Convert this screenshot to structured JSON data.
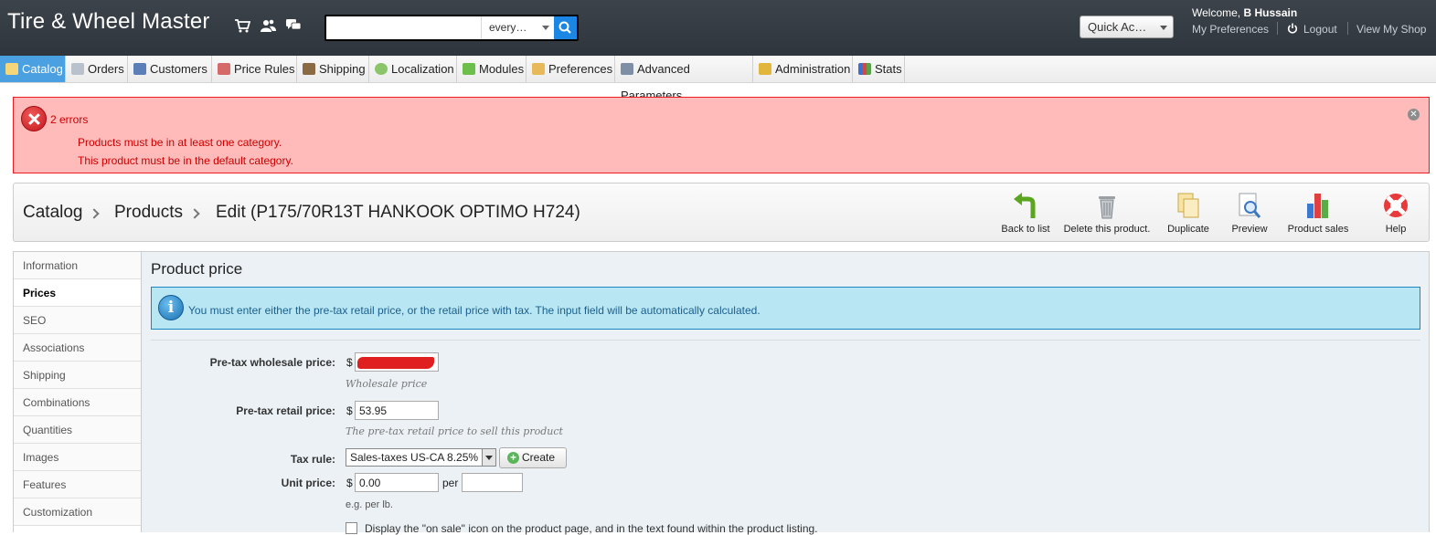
{
  "header": {
    "shop_name": "Tire & Wheel Master",
    "icons": [
      "cart-icon",
      "customers-icon",
      "messages-icon"
    ],
    "search": {
      "value": "",
      "placeholder": "",
      "scope": "every…",
      "button_icon": "search-icon"
    },
    "quick_access": "Quick Ac…",
    "welcome_prefix": "Welcome, ",
    "user_name": "B Hussain",
    "my_preferences": "My Preferences",
    "logout": "Logout",
    "view_shop": "View My Shop"
  },
  "nav": {
    "tabs": [
      {
        "label": "Catalog",
        "icon": "folder-icon",
        "active": true
      },
      {
        "label": "Orders",
        "icon": "cart-icon",
        "active": false
      },
      {
        "label": "Customers",
        "icon": "user-icon",
        "active": false
      },
      {
        "label": "Price Rules",
        "icon": "price-rules-icon",
        "active": false
      },
      {
        "label": "Shipping",
        "icon": "truck-icon",
        "active": false
      },
      {
        "label": "Localization",
        "icon": "globe-icon",
        "active": false
      },
      {
        "label": "Modules",
        "icon": "puzzle-icon",
        "active": false
      },
      {
        "label": "Preferences",
        "icon": "preferences-icon",
        "active": false
      },
      {
        "label": "Advanced Parameters",
        "icon": "wrench-icon",
        "active": false
      },
      {
        "label": "Administration",
        "icon": "key-icon",
        "active": false
      },
      {
        "label": "Stats",
        "icon": "bar-chart-icon",
        "active": false
      }
    ]
  },
  "errors": {
    "count_label": "2 errors",
    "items": [
      "Products must be in at least one category.",
      "This product must be in the default category."
    ]
  },
  "breadcrumb": {
    "items": [
      "Catalog",
      "Products",
      "Edit (P175/70R13T HANKOOK OPTIMO H724)"
    ]
  },
  "toolbar": {
    "buttons": [
      {
        "label": "Back to list",
        "icon": "back-arrow-icon"
      },
      {
        "label": "Delete this product.",
        "icon": "trash-icon"
      },
      {
        "label": "Duplicate",
        "icon": "duplicate-icon"
      },
      {
        "label": "Preview",
        "icon": "preview-icon"
      },
      {
        "label": "Product sales",
        "icon": "sales-chart-icon"
      },
      {
        "label": "Help",
        "icon": "lifebuoy-icon"
      }
    ]
  },
  "product_tabs": {
    "items": [
      "Information",
      "Prices",
      "SEO",
      "Associations",
      "Shipping",
      "Combinations",
      "Quantities",
      "Images",
      "Features",
      "Customization"
    ],
    "active": "Prices"
  },
  "prices": {
    "title": "Product price",
    "info": "You must enter either the pre-tax retail price, or the retail price with tax. The input field will be automatically calculated.",
    "currency": "$",
    "wholesale": {
      "label": "Pre-tax wholesale price:",
      "value": "",
      "hint": "Wholesale price"
    },
    "retail": {
      "label": "Pre-tax retail price:",
      "value": "53.95",
      "hint": "The pre-tax retail price to sell this product"
    },
    "tax_rule": {
      "label": "Tax rule:",
      "value": "Sales-taxes US-CA 8.25%",
      "create": "Create"
    },
    "unit_price": {
      "label": "Unit price:",
      "value": "0.00",
      "per": "per",
      "unity": "",
      "hint": "e.g. per lb."
    },
    "on_sale": {
      "checked": false,
      "label": "Display the \"on sale\" icon on the product page, and in the text found within the product listing."
    }
  },
  "colors": {
    "header_bg": "#353b42",
    "active_tab": "#4aa0e0",
    "error_bg": "#ffbaba",
    "error_text": "#cc0000",
    "info_bg": "#b9e6f3",
    "panel_bg": "#ebf1f5"
  }
}
